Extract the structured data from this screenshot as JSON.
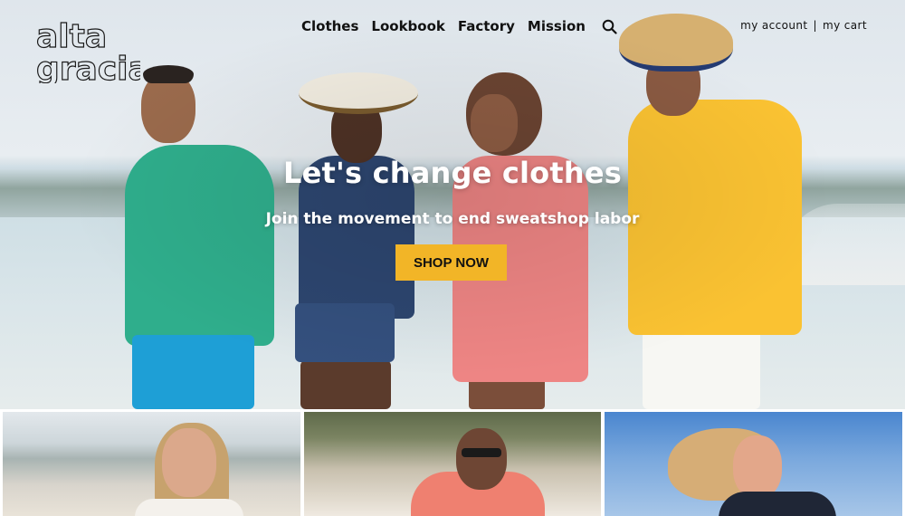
{
  "brand": {
    "logo_line1": "alta",
    "logo_line2": "gracia"
  },
  "nav": {
    "items": [
      "Clothes",
      "Lookbook",
      "Factory",
      "Mission"
    ],
    "search_icon": "search-icon"
  },
  "account": {
    "my_account": "my account",
    "separator": "|",
    "my_cart": "my cart"
  },
  "hero": {
    "title": "Let's change clothes",
    "subtitle": "Join the movement to end sweatshop labor",
    "cta_label": "SHOP NOW"
  },
  "colors": {
    "cta": "#f2b527",
    "text_dark": "#111111",
    "hero_text": "#ffffff"
  }
}
